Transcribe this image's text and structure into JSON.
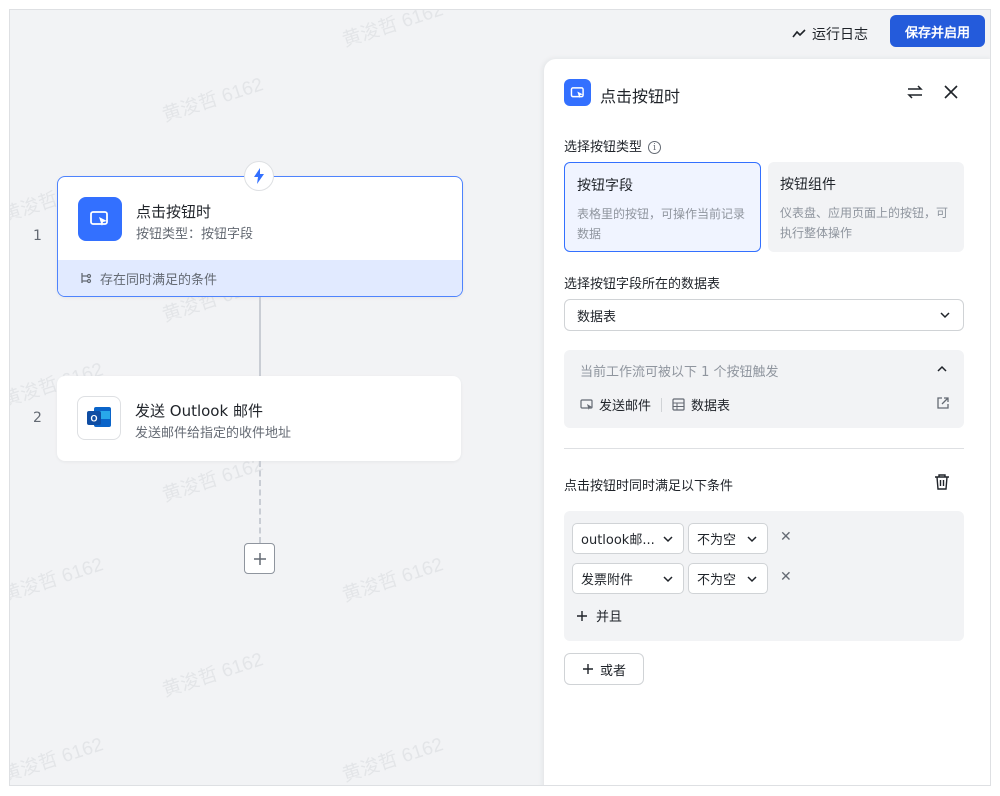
{
  "topbar": {
    "run_log_label": "运行日志",
    "save_label": "保存并启用"
  },
  "flow": {
    "node1": {
      "step": "1",
      "title": "点击按钮时",
      "subtitle": "按钮类型：按钮字段",
      "condition_label": "存在同时满足的条件"
    },
    "node2": {
      "step": "2",
      "title": "发送 Outlook 邮件",
      "subtitle": "发送邮件给指定的收件地址"
    }
  },
  "panel": {
    "title": "点击按钮时",
    "button_type_label": "选择按钮类型",
    "options": [
      {
        "title": "按钮字段",
        "desc": "表格里的按钮，可操作当前记录数据",
        "selected": true
      },
      {
        "title": "按钮组件",
        "desc": "仪表盘、应用页面上的按钮，可执行整体操作",
        "selected": false
      }
    ],
    "table_label": "选择按钮字段所在的数据表",
    "table_value": "数据表",
    "trigger_info": "当前工作流可被以下 1 个按钮触发",
    "trigger_button": "发送邮件",
    "trigger_table": "数据表",
    "conditions_title": "点击按钮时同时满足以下条件",
    "conditions": [
      {
        "field": "outlook邮...",
        "operator": "不为空"
      },
      {
        "field": "发票附件",
        "operator": "不为空"
      }
    ],
    "and_label": "并且",
    "or_label": "或者"
  },
  "watermark": "黄浚哲 6162",
  "colors": {
    "accent": "#3370ff",
    "primary_button": "#245bdb",
    "canvas_bg": "#f2f3f5"
  }
}
